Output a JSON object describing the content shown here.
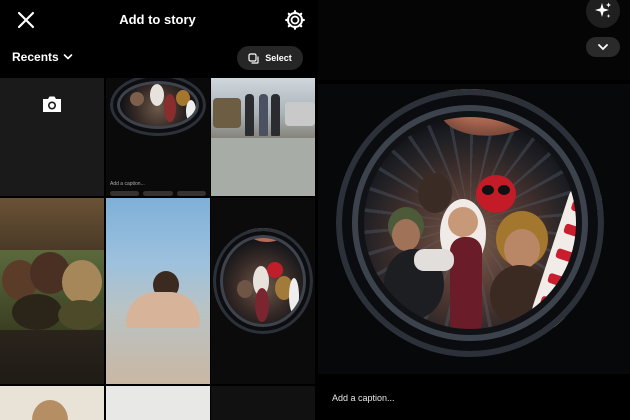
{
  "header": {
    "title": "Add to story",
    "close_icon": "close-icon",
    "settings_icon": "settings-gear-icon"
  },
  "gallery": {
    "album_label": "Recents",
    "select_label": "Select",
    "camera_icon": "camera-icon",
    "thumb_caption": "Add a caption..."
  },
  "preview": {
    "caption_placeholder": "Add a caption...",
    "sparkle_icon": "sparkle-effects-icon",
    "chevron_icon": "chevron-down-icon"
  },
  "colors": {
    "background": "#000000",
    "pill": "#262626",
    "text": "#ffffff"
  }
}
